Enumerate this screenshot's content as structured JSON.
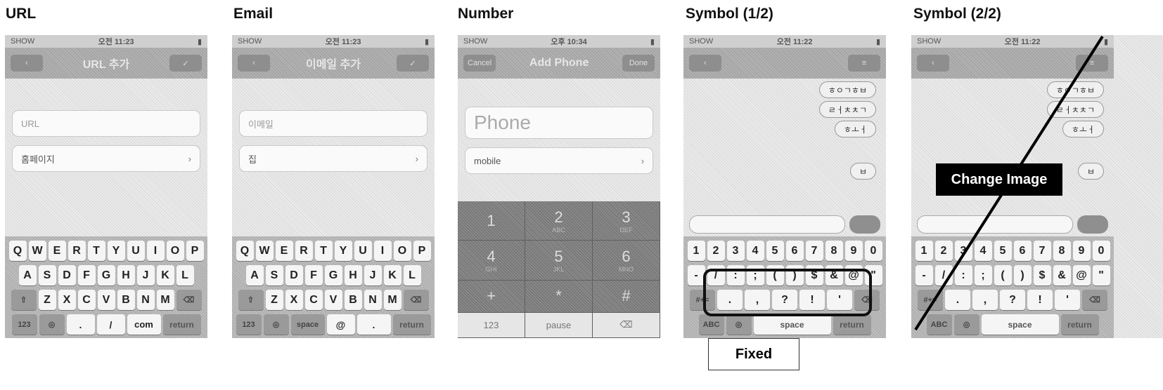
{
  "panels": [
    {
      "title": "URL"
    },
    {
      "title": "Email"
    },
    {
      "title": "Number"
    },
    {
      "title": "Symbol (1/2)"
    },
    {
      "title": "Symbol (2/2)"
    }
  ],
  "url_screen": {
    "status": {
      "carrier": "SHOW",
      "time": "오전 11:23"
    },
    "nav_title": "URL 추가",
    "url_placeholder": "URL",
    "homepage_label": "홈페이지",
    "keys_row1": [
      "Q",
      "W",
      "E",
      "R",
      "T",
      "Y",
      "U",
      "I",
      "O",
      "P"
    ],
    "keys_row2": [
      "A",
      "S",
      "D",
      "F",
      "G",
      "H",
      "J",
      "K",
      "L"
    ],
    "keys_row3": [
      "Z",
      "X",
      "C",
      "V",
      "B",
      "N",
      "M"
    ],
    "bottom_keys": [
      "123",
      ".",
      "/",
      "com",
      "return"
    ]
  },
  "email_screen": {
    "status": {
      "carrier": "SHOW",
      "time": "오전 11:23"
    },
    "nav_title": "이메일 추가",
    "email_placeholder": "이메일",
    "home_label": "집",
    "keys_row1": [
      "Q",
      "W",
      "E",
      "R",
      "T",
      "Y",
      "U",
      "I",
      "O",
      "P"
    ],
    "keys_row2": [
      "A",
      "S",
      "D",
      "F",
      "G",
      "H",
      "J",
      "K",
      "L"
    ],
    "keys_row3": [
      "Z",
      "X",
      "C",
      "V",
      "B",
      "N",
      "M"
    ],
    "bottom_keys": [
      "123",
      "space",
      "@",
      ".",
      "return"
    ]
  },
  "number_screen": {
    "status": {
      "carrier": "SHOW",
      "time": "오후 10:34"
    },
    "cancel_label": "Cancel",
    "nav_title": "Add Phone",
    "done_label": "Done",
    "phone_placeholder": "Phone",
    "mobile_label": "mobile",
    "numpad": [
      {
        "digit": "1",
        "letters": ""
      },
      {
        "digit": "2",
        "letters": "ABC"
      },
      {
        "digit": "3",
        "letters": "DEF"
      },
      {
        "digit": "4",
        "letters": "GHI"
      },
      {
        "digit": "5",
        "letters": "JKL"
      },
      {
        "digit": "6",
        "letters": "MNO"
      },
      {
        "digit": "+",
        "letters": ""
      },
      {
        "digit": "*",
        "letters": ""
      },
      {
        "digit": "#",
        "letters": ""
      },
      {
        "digit": "123",
        "letters": ""
      },
      {
        "digit": "pause",
        "letters": ""
      },
      {
        "digit": "⌫",
        "letters": ""
      }
    ]
  },
  "symbol_screen_1": {
    "status": {
      "carrier": "SHOW",
      "time": "오전 11:22"
    },
    "bubbles": [
      "ㅎㅇㄱㅎㅂ",
      "ㄹㅓㅊㅊㄱ",
      "ㅎㅗㅓ",
      "ㅂ"
    ],
    "keys_row1": [
      "1",
      "2",
      "3",
      "4",
      "5",
      "6",
      "7",
      "8",
      "9",
      "0"
    ],
    "keys_row2": [
      "-",
      "/",
      ":",
      ";",
      "(",
      ")",
      "$",
      "&",
      "@",
      "\""
    ],
    "keys_row3": [
      ".",
      ",",
      "?",
      "!",
      "'"
    ],
    "bottom_keys": [
      "ABC",
      "space",
      "return"
    ]
  },
  "symbol_screen_2": {
    "status": {
      "carrier": "SHOW",
      "time": "오전 11:22"
    },
    "bubbles": [
      "ㅎㅇㄱㅎㅂ",
      "ㄹㅓㅊㅊㄱ",
      "ㅎㅗㅓ",
      "ㅂ"
    ],
    "keys_row1": [
      "1",
      "2",
      "3",
      "4",
      "5",
      "6",
      "7",
      "8",
      "9",
      "0"
    ],
    "keys_row2": [
      "-",
      "/",
      ":",
      ";",
      "(",
      ")",
      "$",
      "&",
      "@",
      "\""
    ],
    "keys_row3": [
      ".",
      ",",
      "?",
      "!",
      "'"
    ],
    "bottom_keys": [
      "ABC",
      "space",
      "return"
    ]
  },
  "annotations": {
    "fixed_label": "Fixed",
    "change_image_label": "Change Image"
  }
}
